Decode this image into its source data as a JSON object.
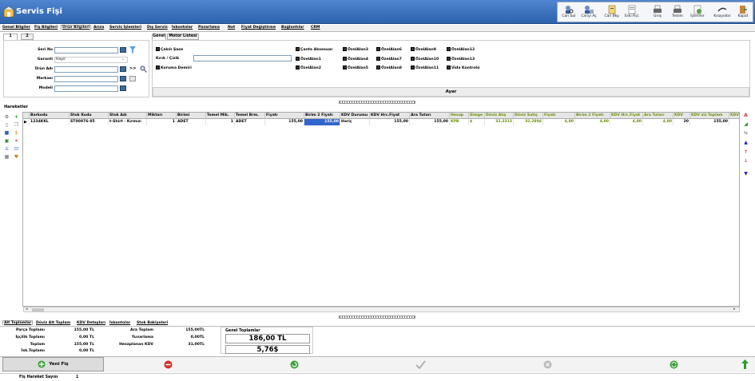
{
  "window": {
    "title": "Servis Fişi"
  },
  "toolbar": [
    {
      "label": "Cari bul",
      "icon": "find-customer-icon"
    },
    {
      "label": "Cariyi Aç",
      "icon": "open-customer-icon"
    },
    {
      "label": "Cari Bky.",
      "icon": "customer-balance-icon"
    },
    {
      "label": "Eski Fişl.",
      "icon": "old-receipts-icon"
    },
    {
      "label": "Giriş",
      "icon": "printer-icon"
    },
    {
      "label": "Teslim",
      "icon": "printer-icon"
    },
    {
      "label": "İşlemler",
      "icon": "operations-icon"
    },
    {
      "label": "Kısayollar",
      "icon": "shortcuts-icon"
    },
    {
      "label": "Kapat",
      "icon": "exit-icon"
    }
  ],
  "main_tabs": [
    "Genel Bilgiler",
    "Fiş Bilgileri",
    "Ürün Bilgileri",
    "Arıza",
    "Servis İşlemleri",
    "Dış Servis",
    "İskontolar",
    "Pazarlama",
    "Not",
    "Fiyat Değiştirme",
    "Bağlantılar",
    "CRM"
  ],
  "number_tabs": [
    "1",
    "2"
  ],
  "product": {
    "serial_label": "Seri No",
    "serial_value": "",
    "warranty_label": "Garanti",
    "warranty_value": "Hayır",
    "product_label": "Ürün Adı",
    "product_value": "",
    "brand_label": "Markası",
    "brand_value": "",
    "model_label": "Modeli",
    "model_value": "",
    "arrows": ">>"
  },
  "general_tabs": [
    "Genel",
    "Motor Listesi"
  ],
  "checks": {
    "col1": [
      "Çakılı Şase",
      "Kırık / Çizik",
      "Koruma Demiri"
    ],
    "col2": [
      "Çanta Aksesuar",
      "ÖzelAlan1",
      "ÖzelAlan2"
    ],
    "col3": [
      "ÖzelAlan3",
      "ÖzelAlan4",
      "ÖzelAlan5"
    ],
    "col4": [
      "ÖzelAlan6",
      "ÖzelAlan7",
      "ÖzelAlan8"
    ],
    "col5": [
      "ÖzelAlan9",
      "ÖzelAlan10",
      "ÖzelAlan11"
    ],
    "col6": [
      "ÖzelAlan12",
      "ÖzelAlan13",
      "Vida Kontrolü"
    ]
  },
  "settings_button": "Ayar",
  "movements": {
    "title": "Hareketler",
    "columns": [
      "Barkodu",
      "Stok Kodu",
      "Stok Adı",
      "Miktarı",
      "Birimi",
      "Temel Mik.",
      "Temel Brm.",
      "Fiyatı",
      "Birim 2 Fiyatı",
      "KDV Durumu",
      "KDV Hrc.Fiyat",
      "Ara Tutarı",
      "Hesap",
      "Simge",
      "Döviz Alış",
      "Döviz Satış",
      "Fiyatı",
      "Birim 2 Fiyatı",
      "KDV Hrc.Fiyat",
      "Ara Tutarı",
      "KDV",
      "KDV siz Toplam",
      "KDV"
    ],
    "rows": [
      [
        "1234KKL",
        "ST00076-85",
        "t-Shirt - Kırmızı",
        "1",
        "ADET",
        "1",
        "ADET",
        "155,00",
        "155,00",
        "Hariç",
        "155,00",
        "155,00",
        "KPB",
        "$",
        "32,2313",
        "32,2894",
        "4,80",
        "4,80",
        "4,80",
        "4,80",
        "20",
        "155,00",
        ""
      ]
    ]
  },
  "bottom_tabs": [
    "Alt Toplamlar",
    "Döviz Alt Toplam",
    "KDV Detayları",
    "İskontolar",
    "Stok Bakiyeleri"
  ],
  "totals": {
    "parts_label": "Parça Toplamı",
    "parts_value": "155,00 TL",
    "labor_label": "İşçilik Toplamı",
    "labor_value": "0,00 TL",
    "total_label": "Toplam",
    "total_value": "155,00 TL",
    "discount_label": "İsk.Toplamı",
    "discount_value": "0,00 TL",
    "subtotal_label": "Ara Toplam",
    "subtotal_value": "155,00TL",
    "rounding_label": "Yuvarlama",
    "rounding_value": "0,00TL",
    "vat_label": "Hesaplanan KDV",
    "vat_value": "31,00TL",
    "grand_label": "Genel Toplamlar",
    "grand_tl": "186,00 TL",
    "grand_usd": "5,76$"
  },
  "new_receipt": "Yeni Fiş",
  "status": {
    "label": "Fiş Hareket Sayısı",
    "value": "1"
  },
  "colors": {
    "title_bar": "#3b72c0",
    "selected_cell": "#3366cc",
    "foreign_columns_text": "#6a8f00"
  }
}
